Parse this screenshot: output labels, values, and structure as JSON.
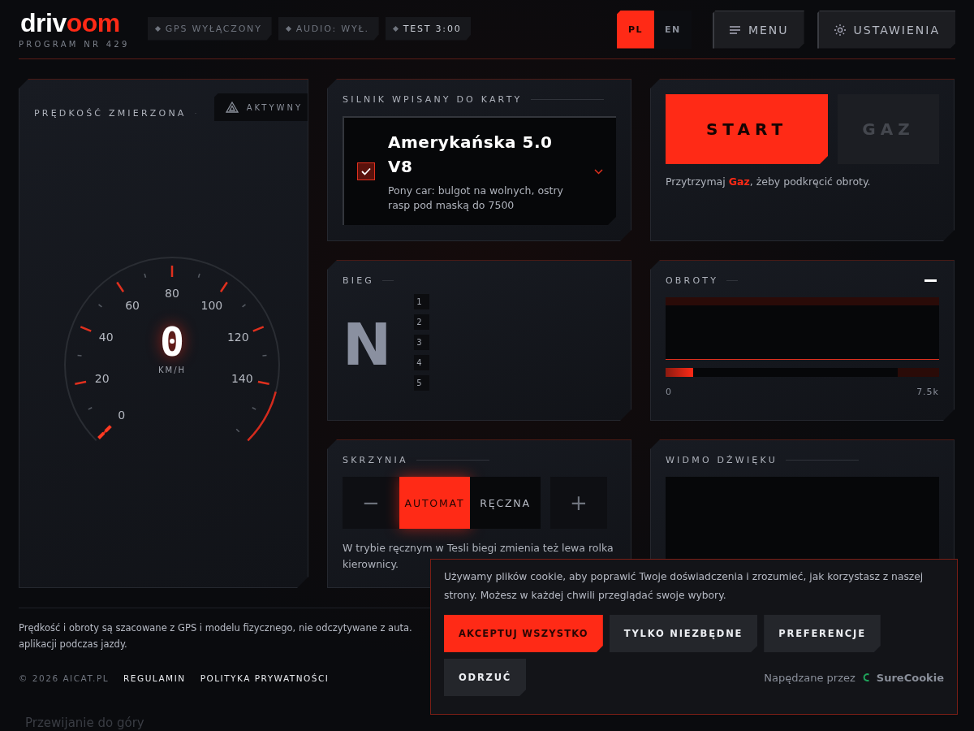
{
  "header": {
    "logo": {
      "prefix": "driv",
      "highlight": "oom"
    },
    "subtitle": "PROGRAM NR 429",
    "pills": [
      {
        "label": "GPS WYŁĄCZONY",
        "active": false
      },
      {
        "label": "AUDIO: WYŁ.",
        "active": false
      },
      {
        "label": "TEST 3:00",
        "active": true
      }
    ],
    "languages": [
      {
        "label": "PL",
        "selected": true
      },
      {
        "label": "EN",
        "selected": false
      }
    ],
    "menu_button": "MENU",
    "settings_button": "USTAWIENIA"
  },
  "speed_panel": {
    "title": "PRĘDKOŚĆ ZMIERZONA",
    "badge": "AKTYWNY",
    "value": "0",
    "unit": "KM/H",
    "scale": [
      "0",
      "20",
      "40",
      "60",
      "80",
      "100",
      "120",
      "140"
    ]
  },
  "engine_panel": {
    "title": "SILNIK WPISANY DO KARTY",
    "checked": true,
    "name": "Amerykańska 5.0 V8",
    "description": "Pony car: bulgot na wolnych, ostry rasp pod maską do 7500"
  },
  "controls_panel": {
    "start_button": "START",
    "gas_button": "GAZ",
    "gas_disabled": true,
    "hint": "Przytrzymaj **Gaz**, żeby podkręcić obroty."
  },
  "gear_panel": {
    "title": "BIEG",
    "current": "N",
    "gears": [
      "1",
      "2",
      "3",
      "4",
      "5"
    ]
  },
  "rpm_panel": {
    "title": "OBROTY",
    "level": 0.1,
    "min_label": "0",
    "max_label": "7.5k"
  },
  "gearbox_panel": {
    "title": "SKRZYNIA",
    "minus": "−",
    "plus": "+",
    "modes": [
      {
        "label": "AUTOMAT",
        "selected": true
      },
      {
        "label": "RĘCZNA",
        "selected": false
      }
    ],
    "note": [
      "W trybie ręcznym w Tesli biegi zmienia też lewa rolka",
      "kierownicy."
    ]
  },
  "spectrum_panel": {
    "title": "WIDMO DŹWIĘKU"
  },
  "footer": {
    "disclaimer": [
      "Prędkość i obroty są szacowane z GPS i modelu fizycznego, nie odczytywane z auta.",
      "aplikacji podczas jazdy."
    ],
    "copyright": "© 2026 AICAT.PL",
    "links": [
      "REGULAMIN",
      "POLITYKA PRYWATNOŚCI"
    ],
    "scroll_top": "Przewijanie do góry"
  },
  "cookie_banner": {
    "text": "Używamy plików cookie, aby poprawić Twoje doświadczenia i zrozumieć, jak korzystasz z naszej strony. Możesz w każdej chwili przeglądać swoje wybory.",
    "buttons": [
      {
        "label": "AKCEPTUJ WSZYSTKO",
        "kind": "primary"
      },
      {
        "label": "TYLKO NIEZBĘDNE",
        "kind": "secondary"
      },
      {
        "label": "PREFERENCJE",
        "kind": "secondary"
      },
      {
        "label": "ODRZUĆ",
        "kind": "secondary"
      }
    ],
    "powered_by": "Napędzane przez",
    "brand": "SureCookie"
  }
}
